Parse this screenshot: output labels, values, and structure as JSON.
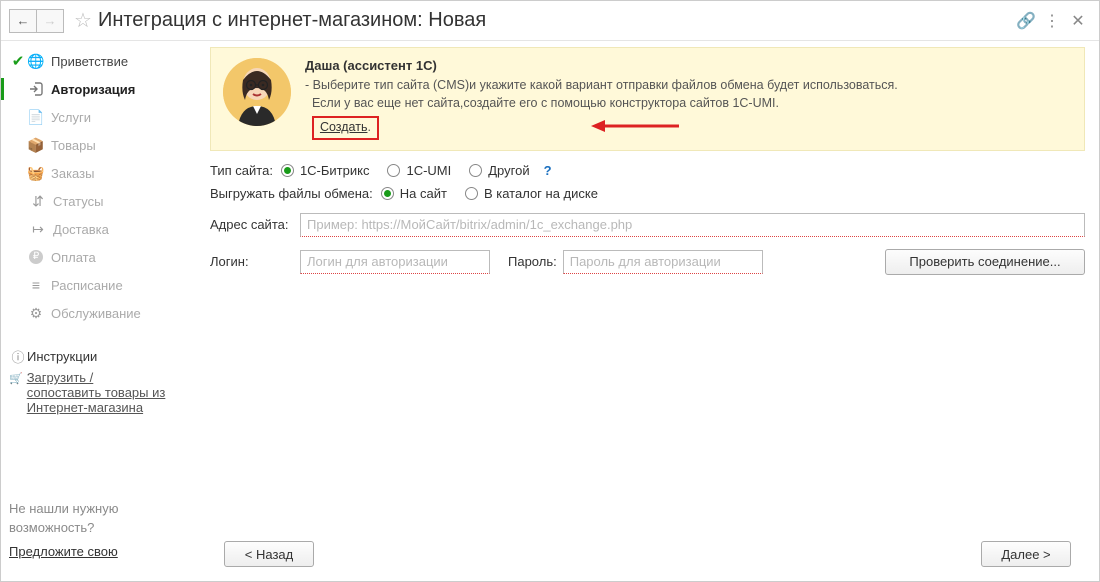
{
  "title": "Интеграция с интернет-магазином: Новая",
  "sidebar": {
    "items": [
      {
        "label": "Приветствие",
        "done": true
      },
      {
        "label": "Авторизация",
        "active": true
      },
      {
        "label": "Услуги"
      },
      {
        "label": "Товары"
      },
      {
        "label": "Заказы"
      },
      {
        "label": "Статусы",
        "sub": true
      },
      {
        "label": "Доставка",
        "sub": true
      },
      {
        "label": "Оплата",
        "sub": true
      },
      {
        "label": "Расписание"
      },
      {
        "label": "Обслуживание"
      }
    ],
    "instructions": "Инструкции",
    "load_match_line1": "Загрузить /",
    "load_match_line2": "сопоставить товары из",
    "load_match_line3": "Интернет-магазина",
    "not_found_l1": "Не нашли нужную",
    "not_found_l2": "возможность?",
    "suggest": "Предложите свою"
  },
  "assistant": {
    "name": "Даша (ассистент 1С)",
    "line1": "- Выберите тип сайта (CMS)и укажите какой вариант отправки файлов обмена будет использоваться.",
    "line2_a": "Если у вас еще нет сайта,создайте его с помощью конструктора сайтов 1C-UMI.",
    "create": "Создать"
  },
  "form": {
    "site_type_label": "Тип сайта:",
    "site_type_options": {
      "bitrix": "1С-Битрикс",
      "umi": "1C-UMI",
      "other": "Другой"
    },
    "upload_label": "Выгружать файлы обмена:",
    "upload_options": {
      "site": "На сайт",
      "disk": "В каталог на диске"
    },
    "address_label": "Адрес сайта:",
    "address_placeholder": "Пример: https://МойСайт/bitrix/admin/1c_exchange.php",
    "login_label": "Логин:",
    "login_placeholder": "Логин для авторизации",
    "password_label": "Пароль:",
    "password_placeholder": "Пароль для авторизации",
    "check_btn": "Проверить соединение..."
  },
  "footer": {
    "back": "< Назад",
    "next": "Далее >"
  }
}
